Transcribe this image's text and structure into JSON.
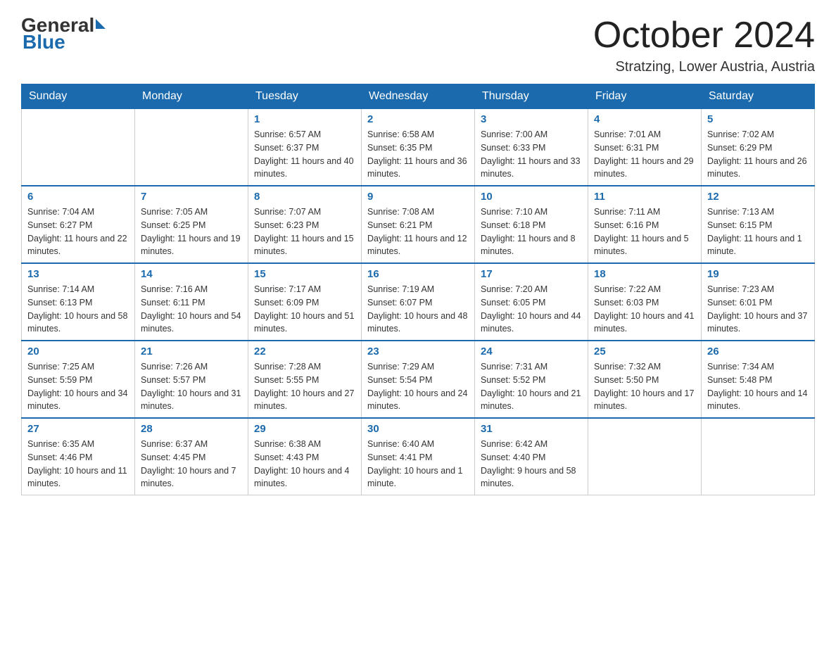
{
  "header": {
    "logo_general": "General",
    "logo_blue": "Blue",
    "month_title": "October 2024",
    "location": "Stratzing, Lower Austria, Austria"
  },
  "weekdays": [
    "Sunday",
    "Monday",
    "Tuesday",
    "Wednesday",
    "Thursday",
    "Friday",
    "Saturday"
  ],
  "weeks": [
    [
      {
        "day": "",
        "sunrise": "",
        "sunset": "",
        "daylight": ""
      },
      {
        "day": "",
        "sunrise": "",
        "sunset": "",
        "daylight": ""
      },
      {
        "day": "1",
        "sunrise": "Sunrise: 6:57 AM",
        "sunset": "Sunset: 6:37 PM",
        "daylight": "Daylight: 11 hours and 40 minutes."
      },
      {
        "day": "2",
        "sunrise": "Sunrise: 6:58 AM",
        "sunset": "Sunset: 6:35 PM",
        "daylight": "Daylight: 11 hours and 36 minutes."
      },
      {
        "day": "3",
        "sunrise": "Sunrise: 7:00 AM",
        "sunset": "Sunset: 6:33 PM",
        "daylight": "Daylight: 11 hours and 33 minutes."
      },
      {
        "day": "4",
        "sunrise": "Sunrise: 7:01 AM",
        "sunset": "Sunset: 6:31 PM",
        "daylight": "Daylight: 11 hours and 29 minutes."
      },
      {
        "day": "5",
        "sunrise": "Sunrise: 7:02 AM",
        "sunset": "Sunset: 6:29 PM",
        "daylight": "Daylight: 11 hours and 26 minutes."
      }
    ],
    [
      {
        "day": "6",
        "sunrise": "Sunrise: 7:04 AM",
        "sunset": "Sunset: 6:27 PM",
        "daylight": "Daylight: 11 hours and 22 minutes."
      },
      {
        "day": "7",
        "sunrise": "Sunrise: 7:05 AM",
        "sunset": "Sunset: 6:25 PM",
        "daylight": "Daylight: 11 hours and 19 minutes."
      },
      {
        "day": "8",
        "sunrise": "Sunrise: 7:07 AM",
        "sunset": "Sunset: 6:23 PM",
        "daylight": "Daylight: 11 hours and 15 minutes."
      },
      {
        "day": "9",
        "sunrise": "Sunrise: 7:08 AM",
        "sunset": "Sunset: 6:21 PM",
        "daylight": "Daylight: 11 hours and 12 minutes."
      },
      {
        "day": "10",
        "sunrise": "Sunrise: 7:10 AM",
        "sunset": "Sunset: 6:18 PM",
        "daylight": "Daylight: 11 hours and 8 minutes."
      },
      {
        "day": "11",
        "sunrise": "Sunrise: 7:11 AM",
        "sunset": "Sunset: 6:16 PM",
        "daylight": "Daylight: 11 hours and 5 minutes."
      },
      {
        "day": "12",
        "sunrise": "Sunrise: 7:13 AM",
        "sunset": "Sunset: 6:15 PM",
        "daylight": "Daylight: 11 hours and 1 minute."
      }
    ],
    [
      {
        "day": "13",
        "sunrise": "Sunrise: 7:14 AM",
        "sunset": "Sunset: 6:13 PM",
        "daylight": "Daylight: 10 hours and 58 minutes."
      },
      {
        "day": "14",
        "sunrise": "Sunrise: 7:16 AM",
        "sunset": "Sunset: 6:11 PM",
        "daylight": "Daylight: 10 hours and 54 minutes."
      },
      {
        "day": "15",
        "sunrise": "Sunrise: 7:17 AM",
        "sunset": "Sunset: 6:09 PM",
        "daylight": "Daylight: 10 hours and 51 minutes."
      },
      {
        "day": "16",
        "sunrise": "Sunrise: 7:19 AM",
        "sunset": "Sunset: 6:07 PM",
        "daylight": "Daylight: 10 hours and 48 minutes."
      },
      {
        "day": "17",
        "sunrise": "Sunrise: 7:20 AM",
        "sunset": "Sunset: 6:05 PM",
        "daylight": "Daylight: 10 hours and 44 minutes."
      },
      {
        "day": "18",
        "sunrise": "Sunrise: 7:22 AM",
        "sunset": "Sunset: 6:03 PM",
        "daylight": "Daylight: 10 hours and 41 minutes."
      },
      {
        "day": "19",
        "sunrise": "Sunrise: 7:23 AM",
        "sunset": "Sunset: 6:01 PM",
        "daylight": "Daylight: 10 hours and 37 minutes."
      }
    ],
    [
      {
        "day": "20",
        "sunrise": "Sunrise: 7:25 AM",
        "sunset": "Sunset: 5:59 PM",
        "daylight": "Daylight: 10 hours and 34 minutes."
      },
      {
        "day": "21",
        "sunrise": "Sunrise: 7:26 AM",
        "sunset": "Sunset: 5:57 PM",
        "daylight": "Daylight: 10 hours and 31 minutes."
      },
      {
        "day": "22",
        "sunrise": "Sunrise: 7:28 AM",
        "sunset": "Sunset: 5:55 PM",
        "daylight": "Daylight: 10 hours and 27 minutes."
      },
      {
        "day": "23",
        "sunrise": "Sunrise: 7:29 AM",
        "sunset": "Sunset: 5:54 PM",
        "daylight": "Daylight: 10 hours and 24 minutes."
      },
      {
        "day": "24",
        "sunrise": "Sunrise: 7:31 AM",
        "sunset": "Sunset: 5:52 PM",
        "daylight": "Daylight: 10 hours and 21 minutes."
      },
      {
        "day": "25",
        "sunrise": "Sunrise: 7:32 AM",
        "sunset": "Sunset: 5:50 PM",
        "daylight": "Daylight: 10 hours and 17 minutes."
      },
      {
        "day": "26",
        "sunrise": "Sunrise: 7:34 AM",
        "sunset": "Sunset: 5:48 PM",
        "daylight": "Daylight: 10 hours and 14 minutes."
      }
    ],
    [
      {
        "day": "27",
        "sunrise": "Sunrise: 6:35 AM",
        "sunset": "Sunset: 4:46 PM",
        "daylight": "Daylight: 10 hours and 11 minutes."
      },
      {
        "day": "28",
        "sunrise": "Sunrise: 6:37 AM",
        "sunset": "Sunset: 4:45 PM",
        "daylight": "Daylight: 10 hours and 7 minutes."
      },
      {
        "day": "29",
        "sunrise": "Sunrise: 6:38 AM",
        "sunset": "Sunset: 4:43 PM",
        "daylight": "Daylight: 10 hours and 4 minutes."
      },
      {
        "day": "30",
        "sunrise": "Sunrise: 6:40 AM",
        "sunset": "Sunset: 4:41 PM",
        "daylight": "Daylight: 10 hours and 1 minute."
      },
      {
        "day": "31",
        "sunrise": "Sunrise: 6:42 AM",
        "sunset": "Sunset: 4:40 PM",
        "daylight": "Daylight: 9 hours and 58 minutes."
      },
      {
        "day": "",
        "sunrise": "",
        "sunset": "",
        "daylight": ""
      },
      {
        "day": "",
        "sunrise": "",
        "sunset": "",
        "daylight": ""
      }
    ]
  ]
}
